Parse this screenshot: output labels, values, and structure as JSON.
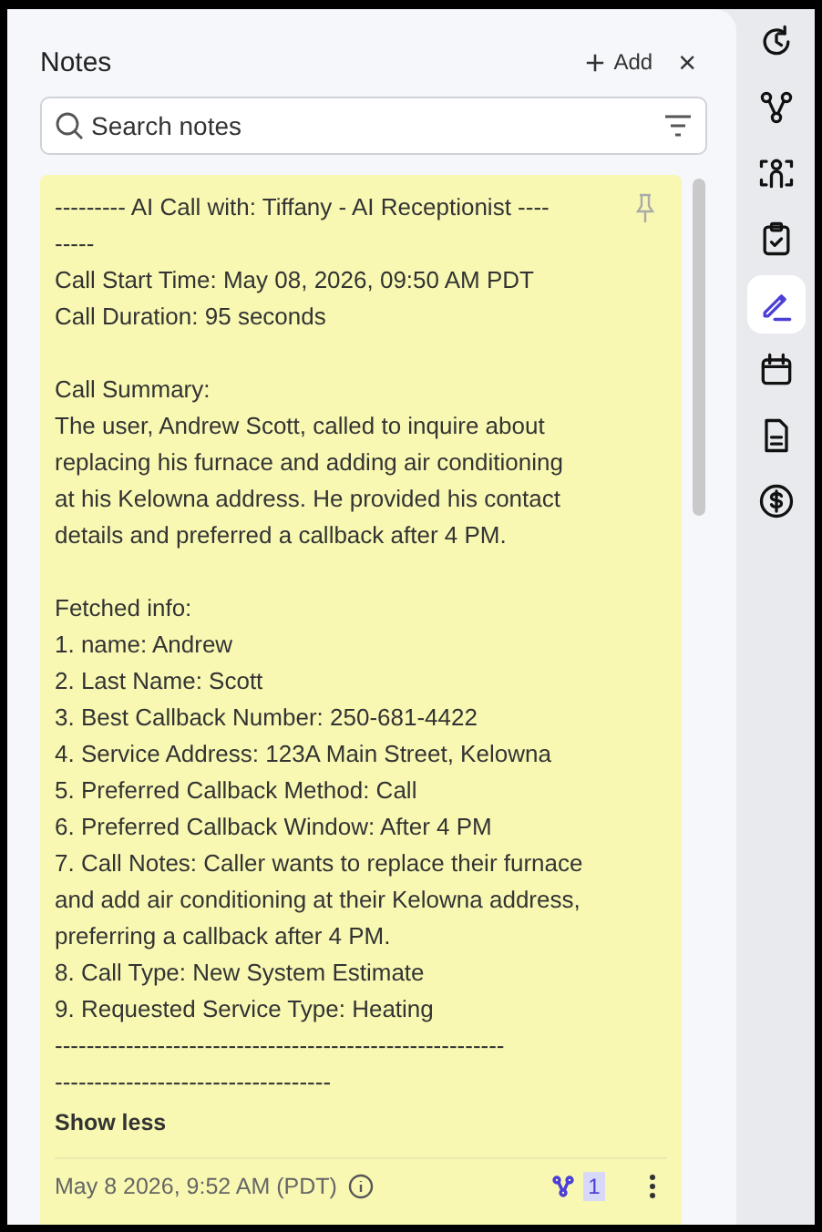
{
  "panel": {
    "title": "Notes",
    "add_label": "Add",
    "close_label": "×"
  },
  "search": {
    "placeholder": "Search notes"
  },
  "note": {
    "pinned": false,
    "blocks": [
      [
        "--------- AI Call with: Tiffany - AI Receptionist ----",
        "-----",
        "Call Start Time: May 08, 2026, 09:50 AM PDT",
        "Call Duration: 95 seconds"
      ],
      [
        "Call Summary:",
        "The user, Andrew Scott, called to inquire about",
        "replacing his furnace and adding air conditioning",
        "at his Kelowna address. He provided his contact",
        "details and preferred a callback after 4 PM."
      ],
      [
        "Fetched info:",
        "1. name: Andrew",
        "2. Last Name: Scott",
        "3. Best Callback Number: 250-681-4422",
        "4. Service Address: 123A Main Street, Kelowna",
        "5. Preferred Callback Method: Call",
        "6. Preferred Callback Window: After 4 PM",
        "7. Call Notes: Caller wants to replace their furnace",
        "and add air conditioning at their Kelowna address,",
        "preferring a callback after 4 PM.",
        "8. Call Type: New System Estimate",
        "9. Requested Service Type: Heating",
        "---------------------------------------------------------",
        "-----------------------------------"
      ]
    ],
    "toggle_label": "Show less",
    "timestamp": "May 8 2026, 9:52 AM (PDT)",
    "link_count": "1"
  },
  "rail": [
    {
      "kind": "history",
      "selected": false
    },
    {
      "kind": "graph",
      "selected": false
    },
    {
      "kind": "team",
      "selected": false
    },
    {
      "kind": "tasks",
      "selected": false
    },
    {
      "kind": "notes",
      "selected": true
    },
    {
      "kind": "calendar",
      "selected": false
    },
    {
      "kind": "document",
      "selected": false
    },
    {
      "kind": "billing",
      "selected": false
    }
  ]
}
